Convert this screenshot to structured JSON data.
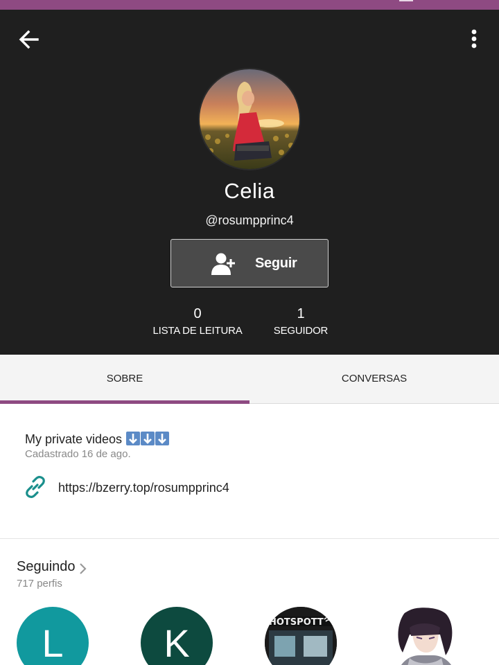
{
  "header": {
    "display_name": "Celia",
    "username": "@rosumpprinc4",
    "follow_label": "Seguir",
    "stats": [
      {
        "value": "0",
        "label": "LISTA DE LEITURA"
      },
      {
        "value": "1",
        "label": "SEGUIDOR"
      }
    ]
  },
  "tabs": [
    {
      "label": "SOBRE",
      "active": true
    },
    {
      "label": "CONVERSAS",
      "active": false
    }
  ],
  "about": {
    "bio": "My private videos",
    "joined": "Cadastrado 16 de ago.",
    "link": "https://bzerry.top/rosumpprinc4"
  },
  "following": {
    "title": "Seguindo",
    "count": "717 perfis",
    "profiles": [
      {
        "letter": "L",
        "color": "#11999e"
      },
      {
        "letter": "K",
        "color": "#0d4a3f"
      },
      {
        "letter": "",
        "icon": "storefront-photo"
      },
      {
        "letter": "",
        "icon": "anime-character-photo"
      }
    ]
  },
  "colors": {
    "accent": "#8e4a82",
    "header_bg": "#1f1f1f",
    "link_icon": "#1a8f8c"
  },
  "icons": {
    "back": "arrow-left-icon",
    "menu": "more-vertical-icon",
    "follow": "add-person-icon",
    "link": "link-icon",
    "chevron": "chevron-right-icon"
  }
}
